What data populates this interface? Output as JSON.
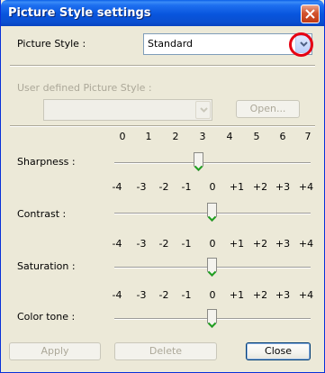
{
  "window": {
    "title": "Picture Style settings"
  },
  "picture_style": {
    "label": "Picture Style :",
    "value": "Standard"
  },
  "user_defined": {
    "label": "User defined Picture Style :",
    "value": "",
    "open_label": "Open..."
  },
  "sharpness": {
    "label": "Sharpness :",
    "ticks": [
      "0",
      "1",
      "2",
      "3",
      "4",
      "5",
      "6",
      "7"
    ],
    "value": 3
  },
  "contrast": {
    "label": "Contrast :",
    "ticks": [
      "-4",
      "-3",
      "-2",
      "-1",
      "0",
      "+1",
      "+2",
      "+3",
      "+4"
    ],
    "value": 0
  },
  "saturation": {
    "label": "Saturation :",
    "ticks": [
      "-4",
      "-3",
      "-2",
      "-1",
      "0",
      "+1",
      "+2",
      "+3",
      "+4"
    ],
    "value": 0
  },
  "color_tone": {
    "label": "Color tone :",
    "ticks": [
      "-4",
      "-3",
      "-2",
      "-1",
      "0",
      "+1",
      "+2",
      "+3",
      "+4"
    ],
    "value": 0
  },
  "buttons": {
    "apply": "Apply",
    "delete": "Delete",
    "close": "Close"
  },
  "colors": {
    "titlebar": "#0a55dd",
    "highlight_ring": "#e60012",
    "thumb_accent": "#21a121"
  }
}
